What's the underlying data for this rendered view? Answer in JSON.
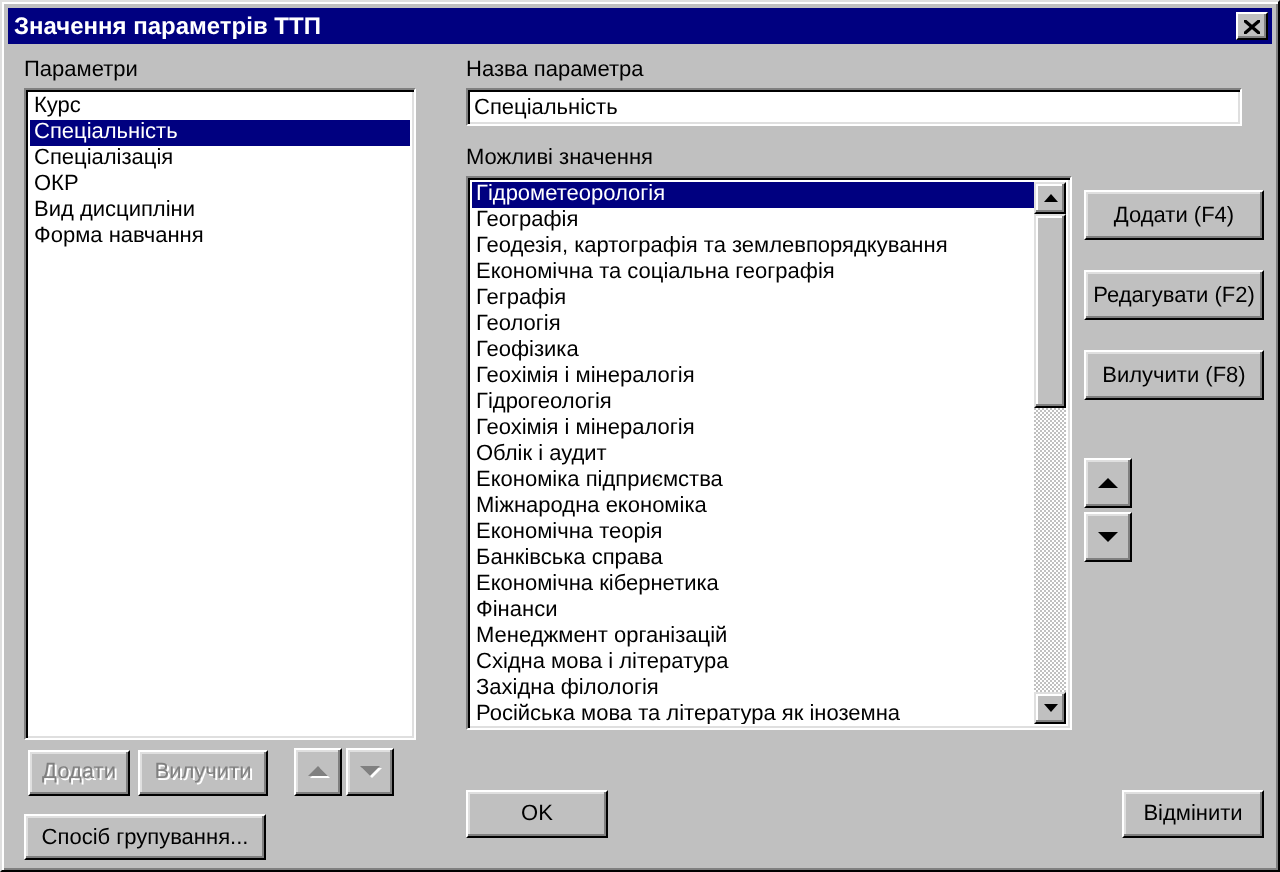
{
  "window": {
    "title": "Значення параметрів ТТП"
  },
  "parameters": {
    "label": "Параметри",
    "items": [
      {
        "label": "Курс",
        "selected": false
      },
      {
        "label": "Спеціальність",
        "selected": true
      },
      {
        "label": "Спеціалізація",
        "selected": false
      },
      {
        "label": "ОКР",
        "selected": false
      },
      {
        "label": "Вид дисципліни",
        "selected": false
      },
      {
        "label": "Форма навчання",
        "selected": false
      }
    ]
  },
  "parameter_buttons": [
    {
      "label": "Додати",
      "disabled": true
    },
    {
      "label": "Вилучити",
      "disabled": true
    }
  ],
  "parameter_arrows": [
    {
      "kind": "up",
      "disabled": true
    },
    {
      "kind": "down",
      "disabled": true
    }
  ],
  "grouping_button": {
    "label": "Спосіб групування...",
    "disabled": false
  },
  "name_field": {
    "label": "Назва параметра",
    "value": "Спеціальність"
  },
  "values": {
    "label": "Можливі значення",
    "items": [
      {
        "label": "Гідрометеорологія",
        "selected": true
      },
      {
        "label": "Географія",
        "selected": false
      },
      {
        "label": "Геодезія, картографія та землевпорядкування",
        "selected": false
      },
      {
        "label": "Економічна та соціальна географія",
        "selected": false
      },
      {
        "label": "Геграфія",
        "selected": false
      },
      {
        "label": "Геологія",
        "selected": false
      },
      {
        "label": "Геофізика",
        "selected": false
      },
      {
        "label": "Геохімія і мінералогія",
        "selected": false
      },
      {
        "label": "Гідрогеологія",
        "selected": false
      },
      {
        "label": "Геохімія і мінералогія",
        "selected": false
      },
      {
        "label": "Облік і аудит",
        "selected": false
      },
      {
        "label": "Економіка підприємства",
        "selected": false
      },
      {
        "label": "Міжнародна економіка",
        "selected": false
      },
      {
        "label": "Економічна теорія",
        "selected": false
      },
      {
        "label": "Банківська справа",
        "selected": false
      },
      {
        "label": "Економічна кібернетика",
        "selected": false
      },
      {
        "label": "Фінанси",
        "selected": false
      },
      {
        "label": "Менеджмент організацій",
        "selected": false
      },
      {
        "label": "Східна мова і література",
        "selected": false
      },
      {
        "label": "Західна філологія",
        "selected": false
      },
      {
        "label": "Російська мова та література як іноземна",
        "selected": false
      }
    ]
  },
  "value_buttons": [
    {
      "label": "Додати (F4)",
      "disabled": false
    },
    {
      "label": "Редагувати (F2)",
      "disabled": false
    },
    {
      "label": "Вилучити (F8)",
      "disabled": false
    }
  ],
  "value_arrows": [
    {
      "kind": "up",
      "disabled": false
    },
    {
      "kind": "down",
      "disabled": false
    }
  ],
  "ok_button": {
    "label": "OK",
    "disabled": false
  },
  "cancel_button": {
    "label": "Відмінити",
    "disabled": false
  }
}
